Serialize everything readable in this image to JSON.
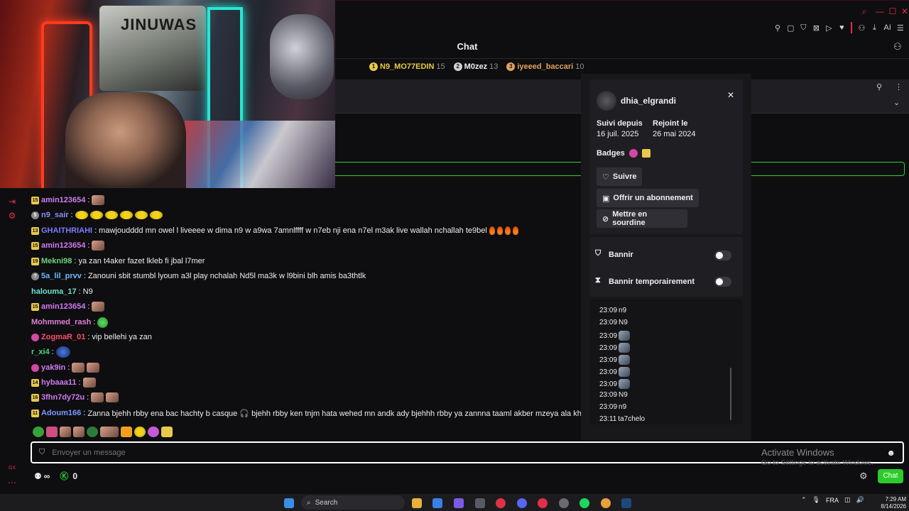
{
  "window": {
    "controls": {
      "search": "⌕",
      "minimize": "—",
      "maximize": "☐",
      "close": "✕"
    }
  },
  "toolbar": {
    "ai_label": "AI"
  },
  "chat": {
    "title": "Chat",
    "leaderboard": [
      {
        "rank": "1",
        "name": "N9_MO77EDIN",
        "score": "15",
        "color": "#e8c94a"
      },
      {
        "rank": "2",
        "name": "M0zez",
        "score": "13",
        "color": "#cfcfd6"
      },
      {
        "rank": "3",
        "name": "iyeeed_baccari",
        "score": "10",
        "color": "#e0a35a"
      }
    ],
    "messages": [
      {
        "badge": "15",
        "badge_type": "sub",
        "user": "amin123654",
        "color": "#d07bf0",
        "text": "",
        "emotes": [
          "face"
        ]
      },
      {
        "badge": "5",
        "badge_type": "circle",
        "user": "n9_sair",
        "color": "#8a8ff5",
        "text": "",
        "emotes": [
          "yellow",
          "yellow",
          "yellow",
          "yellow",
          "yellow",
          "yellow"
        ]
      },
      {
        "badge": "13",
        "badge_type": "sub",
        "user": "GHAITHRIAHI",
        "color": "#7b7bff",
        "text": "mawjoudddd mn owel l liveeee w dima n9 w a9wa 7amnlffff w n7eb nji ena n7el m3ak live wallah nchallah te9bel",
        "emotes": [
          "fire",
          "fire",
          "fire",
          "fire"
        ]
      },
      {
        "badge": "15",
        "badge_type": "sub",
        "user": "amin123654",
        "color": "#d07bf0",
        "text": "",
        "emotes": [
          "face"
        ]
      },
      {
        "badge": "19",
        "badge_type": "sub",
        "user": "Mekni98",
        "color": "#6fd77a",
        "text": "ya zan t4aker fazet lkleb fi jbal l7mer",
        "emotes": []
      },
      {
        "badge": "?",
        "badge_type": "circle",
        "user": "5a_lil_prvv",
        "color": "#6fb7ff",
        "text": "Zanouni sbit stumbl lyoum a3l play nchalah Nd5l ma3k w l9bini blh amis ba3thtlk",
        "emotes": []
      },
      {
        "badge": "",
        "badge_type": "none",
        "user": "halouma_17",
        "color": "#6fe0d0",
        "text": "N9",
        "emotes": []
      },
      {
        "badge": "15",
        "badge_type": "sub",
        "user": "amin123654",
        "color": "#d07bf0",
        "text": "",
        "emotes": [
          "face"
        ]
      },
      {
        "badge": "",
        "badge_type": "none",
        "user": "Mohmmed_rash",
        "color": "#e17fd8",
        "text": "",
        "emotes": [
          "green"
        ]
      },
      {
        "badge": "",
        "badge_type": "pink",
        "user": "ZogmaR_01",
        "color": "#ff4d6d",
        "text": "vip bellehi ya zan",
        "emotes": []
      },
      {
        "badge": "",
        "badge_type": "none",
        "user": "r_xi4",
        "color": "#4dd77a",
        "text": "",
        "emotes": [
          "blue"
        ]
      },
      {
        "badge": "",
        "badge_type": "pink",
        "user": "yak9in",
        "color": "#d07bf0",
        "text": "",
        "emotes": [
          "face",
          "face"
        ]
      },
      {
        "badge": "14",
        "badge_type": "sub",
        "user": "hybaaa11",
        "color": "#d07bf0",
        "text": "",
        "emotes": [
          "face"
        ]
      },
      {
        "badge": "16",
        "badge_type": "sub",
        "user": "3fhn7dy72u",
        "color": "#d07bf0",
        "text": "",
        "emotes": [
          "face",
          "face"
        ]
      },
      {
        "badge": "11",
        "badge_type": "sub",
        "user": "Adoum166",
        "color": "#7b9bff",
        "text": "Zanna bjehh rbby ena bac hachty b casque 🎧 bjehh rbby ken tnjm hata wehed mn andk ady bjehhh rbby ya zannna taaml akber mzeya ala khoukk",
        "emotes": []
      }
    ],
    "input_placeholder": "Envoyer un message",
    "points_label": "∞",
    "viewers_count": "0",
    "send_button": "Chat",
    "activate_windows": "Activate Windows",
    "activate_windows_sub": "Go to Settings to activate Windows."
  },
  "user_card": {
    "username": "dhia_elgrandi",
    "followed_since_label": "Suivi depuis",
    "followed_since": "16 juil. 2025",
    "joined_label": "Rejoint le",
    "joined": "26 mai 2024",
    "badges_label": "Badges",
    "follow_button": "Suivre",
    "gift_button": "Offrir un abonnement",
    "mute_button": "Mettre en sourdine",
    "ban_label": "Bannir",
    "timeout_label": "Bannir temporairement",
    "log": [
      {
        "time": "23:09",
        "text": "n9",
        "emote": false
      },
      {
        "time": "23:09",
        "text": "N9",
        "emote": false
      },
      {
        "time": "23:09",
        "text": "",
        "emote": true
      },
      {
        "time": "23:09",
        "text": "",
        "emote": true
      },
      {
        "time": "23:09",
        "text": "",
        "emote": true
      },
      {
        "time": "23:09",
        "text": "",
        "emote": true
      },
      {
        "time": "23:09",
        "text": "",
        "emote": true
      },
      {
        "time": "23:09",
        "text": "N9",
        "emote": false
      },
      {
        "time": "23:09",
        "text": "n9",
        "emote": false
      },
      {
        "time": "23:11",
        "text": "ta7chelo",
        "emote": false
      }
    ]
  },
  "video": {
    "poster_text": "JINUWAS"
  },
  "taskbar": {
    "search_placeholder": "Search",
    "language": "FRA",
    "time": "7:29 AM",
    "date": "8/14/2026"
  }
}
